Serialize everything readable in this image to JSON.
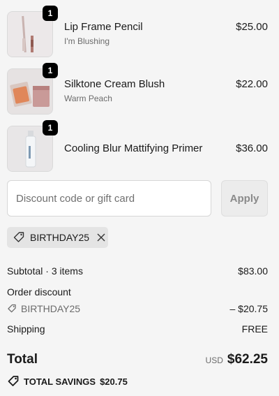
{
  "items": [
    {
      "quantity": "1",
      "name": "Lip Frame Pencil",
      "variant": "I'm Blushing",
      "price": "$25.00",
      "thumb_icon": "lip-pencil-image"
    },
    {
      "quantity": "1",
      "name": "Silktone Cream Blush",
      "variant": "Warm Peach",
      "price": "$22.00",
      "thumb_icon": "cream-blush-image"
    },
    {
      "quantity": "1",
      "name": "Cooling Blur Mattifying Primer",
      "variant": "",
      "price": "$36.00",
      "thumb_icon": "primer-bottle-image"
    }
  ],
  "discount": {
    "placeholder": "Discount code or gift card",
    "apply_label": "Apply",
    "applied_code": "BIRTHDAY25"
  },
  "summary": {
    "subtotal_label": "Subtotal · 3 items",
    "subtotal_value": "$83.00",
    "order_discount_label": "Order discount",
    "discount_code": "BIRTHDAY25",
    "discount_value": "– $20.75",
    "shipping_label": "Shipping",
    "shipping_value": "FREE",
    "total_label": "Total",
    "total_currency": "USD",
    "total_value": "$62.25",
    "savings_label": "TOTAL SAVINGS",
    "savings_value": "$20.75"
  },
  "colors": {
    "background": "#f5f5f5",
    "badge": "#000000",
    "chip": "#e4e4e4"
  }
}
